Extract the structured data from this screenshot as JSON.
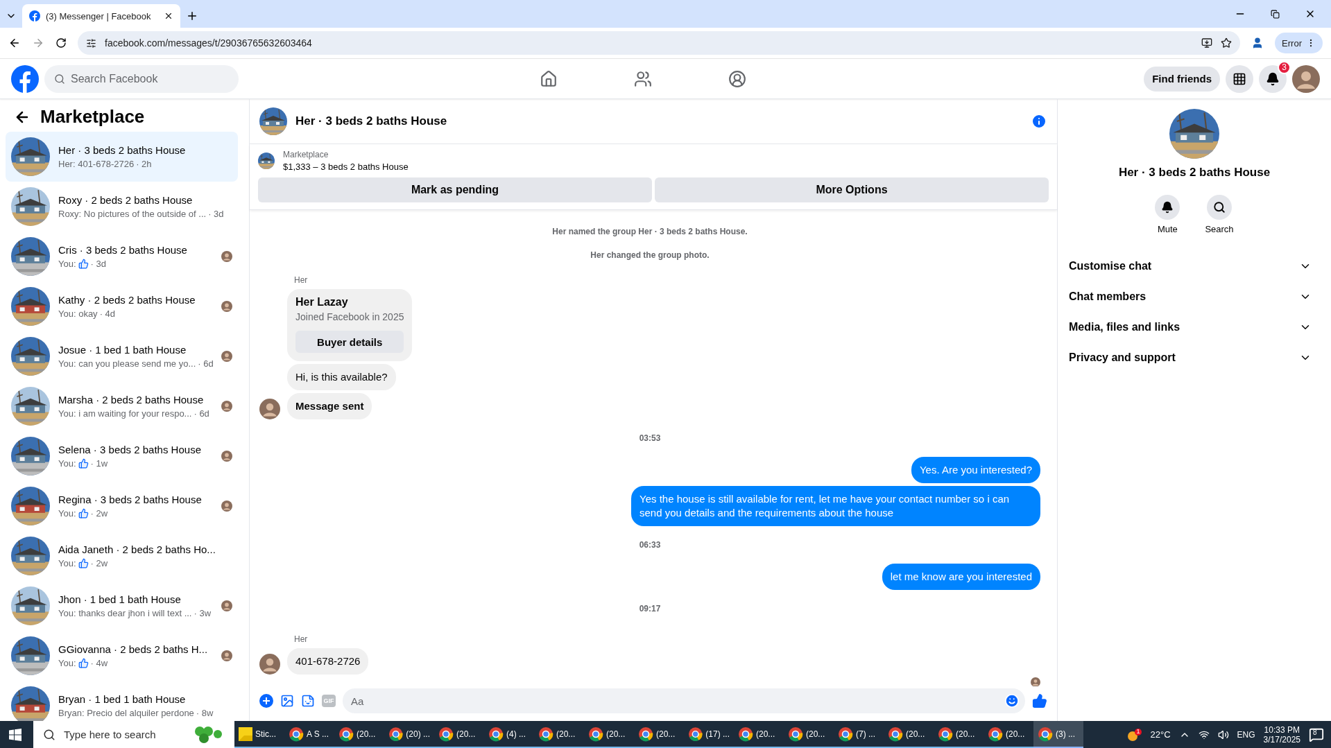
{
  "browser": {
    "tabs": [
      {
        "title": "(3) Messenger | Facebook",
        "selected": true
      }
    ],
    "url": "facebook.com/messages/t/29036765632603464",
    "profile_button": "Error"
  },
  "header": {
    "search_placeholder": "Search Facebook",
    "find_friends": "Find friends",
    "notification_count": "3"
  },
  "sidebar": {
    "title": "Marketplace",
    "conversations": [
      {
        "title": "Her · 3 beds 2 baths House",
        "preview": "Her: 401-678-2726",
        "time": "· 2h",
        "kind": "text",
        "seen": false,
        "selected": true
      },
      {
        "title": "Roxy · 2 beds 2 baths House",
        "preview": "Roxy: No pictures of the outside of ...",
        "time": "· 3d",
        "kind": "text",
        "seen": false,
        "selected": false
      },
      {
        "title": "Cris · 3 beds 2 baths House",
        "preview": "You:",
        "time": "· 3d",
        "kind": "like",
        "seen": true,
        "selected": false
      },
      {
        "title": "Kathy · 2 beds 2 baths House",
        "preview": "You: okay",
        "time": "· 4d",
        "kind": "text",
        "seen": true,
        "selected": false
      },
      {
        "title": "Josue · 1 bed 1 bath House",
        "preview": "You: can you please send me yo...",
        "time": "· 6d",
        "kind": "text",
        "seen": true,
        "selected": false
      },
      {
        "title": "Marsha · 2 beds 2 baths House",
        "preview": "You: i am waiting for your respo...",
        "time": "· 6d",
        "kind": "text",
        "seen": true,
        "selected": false
      },
      {
        "title": "Selena · 3 beds 2 baths House",
        "preview": "You:",
        "time": "· 1w",
        "kind": "like",
        "seen": true,
        "selected": false
      },
      {
        "title": "Regina · 3 beds 2 baths House",
        "preview": "You:",
        "time": "· 2w",
        "kind": "like",
        "seen": true,
        "selected": false
      },
      {
        "title": "Aida Janeth · 2 beds 2 baths Ho...",
        "preview": "You:",
        "time": "· 2w",
        "kind": "like",
        "seen": false,
        "selected": false
      },
      {
        "title": "Jhon · 1 bed 1 bath House",
        "preview": "You: thanks dear jhon i will text ...",
        "time": "· 3w",
        "kind": "text",
        "seen": true,
        "selected": false
      },
      {
        "title": "GGiovanna · 2 beds 2 baths H...",
        "preview": "You:",
        "time": "· 4w",
        "kind": "like",
        "seen": true,
        "selected": false
      },
      {
        "title": "Bryan · 1 bed 1 bath House",
        "preview": "Bryan: Precio del alquiler perdone",
        "time": "· 8w",
        "kind": "text",
        "seen": false,
        "selected": false
      }
    ]
  },
  "chat": {
    "title": "Her · 3 beds 2 baths House",
    "listing": {
      "label": "Marketplace",
      "name": "$1,333 – 3 beds 2 baths House"
    },
    "buttons": [
      "Mark as pending",
      "More Options"
    ],
    "messages": [
      {
        "kind": "event",
        "text": "Her named the group Her · 3 beds 2 baths House."
      },
      {
        "kind": "event",
        "text": "Her changed the group photo."
      },
      {
        "kind": "sender",
        "text": "Her"
      },
      {
        "kind": "card",
        "text": "Her Lazay",
        "sub": "Joined Facebook in 2025",
        "button": "Buyer details"
      },
      {
        "kind": "incoming",
        "text": "Hi, is this available?"
      },
      {
        "kind": "incoming_bold",
        "text": "Message sent",
        "avatar": true
      },
      {
        "kind": "time",
        "text": "03:53"
      },
      {
        "kind": "outgoing",
        "text": "Yes. Are you interested?"
      },
      {
        "kind": "outgoing",
        "text": "Yes the house is still available for rent, let me have your contact number so i can send you details and the requirements about the house"
      },
      {
        "kind": "time",
        "text": "06:33"
      },
      {
        "kind": "outgoing",
        "text": "let me know are you interested"
      },
      {
        "kind": "time",
        "text": "09:17"
      },
      {
        "kind": "sender",
        "text": "Her"
      },
      {
        "kind": "incoming",
        "text": "401-678-2726",
        "avatar": true
      }
    ],
    "composer_placeholder": "Aa",
    "gif_label": "GIF"
  },
  "info": {
    "title": "Her · 3 beds 2 baths House",
    "actions": [
      {
        "kind": "mute",
        "label": "Mute"
      },
      {
        "kind": "search",
        "label": "Search"
      }
    ],
    "sections": [
      {
        "label": "Customise chat",
        "expanded": false
      },
      {
        "label": "Chat members",
        "expanded": false
      },
      {
        "label": "Media, files and links",
        "expanded": false
      },
      {
        "label": "Privacy and support",
        "expanded": false
      }
    ]
  },
  "taskbar": {
    "search_placeholder": "Type here to search",
    "apps": [
      {
        "label": "Stic...",
        "kind": "notes",
        "selected": false
      },
      {
        "label": "A S ...",
        "kind": "chrome",
        "selected": false
      },
      {
        "label": "(20...",
        "kind": "chrome",
        "selected": false
      },
      {
        "label": "(20) ...",
        "kind": "chrome",
        "selected": false
      },
      {
        "label": "(20...",
        "kind": "chrome",
        "selected": false
      },
      {
        "label": "(4) ...",
        "kind": "chrome",
        "selected": false
      },
      {
        "label": "(20...",
        "kind": "chrome",
        "selected": false
      },
      {
        "label": "(20...",
        "kind": "chrome",
        "selected": false
      },
      {
        "label": "(20...",
        "kind": "chrome",
        "selected": false
      },
      {
        "label": "(17) ...",
        "kind": "chrome",
        "selected": false
      },
      {
        "label": "(20...",
        "kind": "chrome",
        "selected": false
      },
      {
        "label": "(20...",
        "kind": "chrome",
        "selected": false
      },
      {
        "label": "(7) ...",
        "kind": "chrome",
        "selected": false
      },
      {
        "label": "(20...",
        "kind": "chrome",
        "selected": false
      },
      {
        "label": "(20...",
        "kind": "chrome",
        "selected": false
      },
      {
        "label": "(20...",
        "kind": "chrome",
        "selected": false
      },
      {
        "label": "(3) ...",
        "kind": "chrome",
        "selected": true
      }
    ],
    "weather_badge": "1",
    "temperature": "22°C",
    "language": "ENG",
    "time": "10:33 PM",
    "date": "3/17/2025",
    "notifications": "8"
  }
}
